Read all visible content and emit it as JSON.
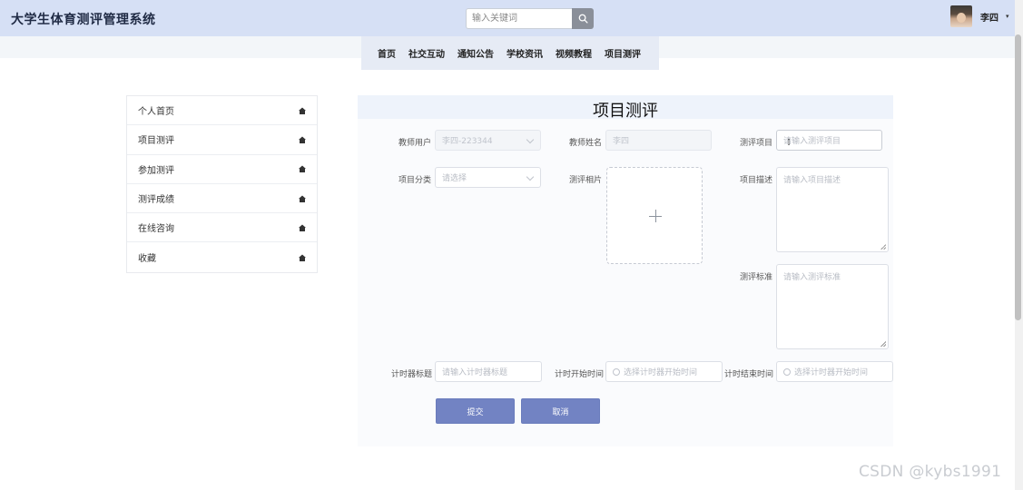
{
  "header": {
    "title": "大学生体育测评管理系统",
    "search_placeholder": "输入关键词",
    "search_icon": "search-icon",
    "username": "李四",
    "caret": "▾"
  },
  "nav": [
    "首页",
    "社交互动",
    "通知公告",
    "学校资讯",
    "视频教程",
    "项目测评"
  ],
  "sidebar": [
    {
      "label": "个人首页",
      "icon": "home-icon"
    },
    {
      "label": "项目测评",
      "icon": "home-icon"
    },
    {
      "label": "参加测评",
      "icon": "home-icon"
    },
    {
      "label": "测评成绩",
      "icon": "home-icon"
    },
    {
      "label": "在线咨询",
      "icon": "home-icon"
    },
    {
      "label": "收藏",
      "icon": "home-icon"
    }
  ],
  "form": {
    "title": "项目测评",
    "teacher_user_label": "教师用户",
    "teacher_user_value": "李四-223344",
    "teacher_name_label": "教师姓名",
    "teacher_name_value": "李四",
    "project_label": "测评项目",
    "project_placeholder": "请输入测评项目",
    "category_label": "项目分类",
    "category_placeholder": "请选择",
    "photo_label": "测评相片",
    "desc_label": "项目描述",
    "desc_placeholder": "请输入项目描述",
    "standard_label": "测评标准",
    "standard_placeholder": "请输入测评标准",
    "timer_title_label": "计时器标题",
    "timer_title_placeholder": "请输入计时器标题",
    "start_label": "计时开始时间",
    "start_placeholder": "选择计时器开始时间",
    "end_label": "计时结束时间",
    "end_placeholder": "选择计时器开始时间",
    "submit": "提交",
    "cancel": "取消"
  },
  "watermark": "CSDN @kybs1991",
  "colors": {
    "header_bg": "#d6e0f5",
    "nav_bg": "#e6ebf5",
    "button": "#7283c3"
  }
}
